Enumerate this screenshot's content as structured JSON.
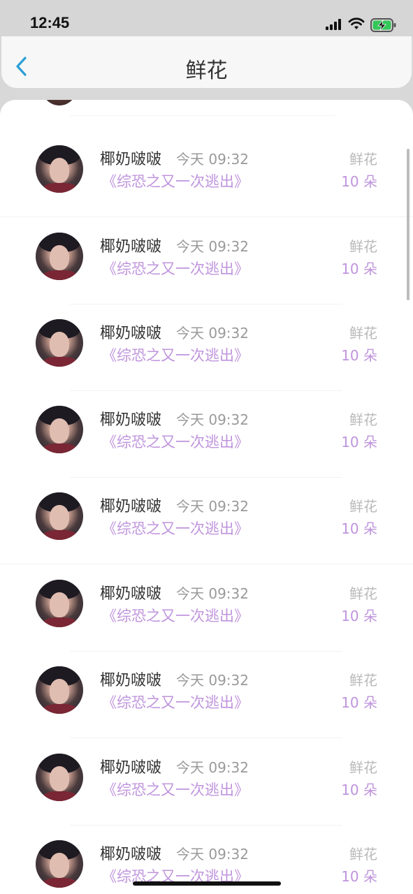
{
  "status_bar": {
    "time": "12:45"
  },
  "nav": {
    "title": "鲜花"
  },
  "records": [
    {
      "user": "椰奶啵啵",
      "time": "今天 09:32",
      "book": "《综恐之又一次逃出》",
      "gift_type": "鲜花",
      "gift_count": "10 朵"
    },
    {
      "user": "椰奶啵啵",
      "time": "今天 09:32",
      "book": "《综恐之又一次逃出》",
      "gift_type": "鲜花",
      "gift_count": "10 朵"
    },
    {
      "user": "椰奶啵啵",
      "time": "今天 09:32",
      "book": "《综恐之又一次逃出》",
      "gift_type": "鲜花",
      "gift_count": "10 朵"
    },
    {
      "user": "椰奶啵啵",
      "time": "今天 09:32",
      "book": "《综恐之又一次逃出》",
      "gift_type": "鲜花",
      "gift_count": "10 朵"
    },
    {
      "user": "椰奶啵啵",
      "time": "今天 09:32",
      "book": "《综恐之又一次逃出》",
      "gift_type": "鲜花",
      "gift_count": "10 朵"
    },
    {
      "user": "椰奶啵啵",
      "time": "今天 09:32",
      "book": "《综恐之又一次逃出》",
      "gift_type": "鲜花",
      "gift_count": "10 朵"
    },
    {
      "user": "椰奶啵啵",
      "time": "今天 09:32",
      "book": "《综恐之又一次逃出》",
      "gift_type": "鲜花",
      "gift_count": "10 朵"
    },
    {
      "user": "椰奶啵啵",
      "time": "今天 09:32",
      "book": "《综恐之又一次逃出》",
      "gift_type": "鲜花",
      "gift_count": "10 朵"
    },
    {
      "user": "椰奶啵啵",
      "time": "今天 09:32",
      "book": "《综恐之又一次逃出》",
      "gift_type": "鲜花",
      "gift_count": "10 朵"
    }
  ],
  "icons": {
    "back": "chevron-left-icon",
    "signal": "cellular-signal-icon",
    "wifi": "wifi-icon",
    "battery": "battery-charging-icon"
  },
  "colors": {
    "accent_purple": "#bf94dd",
    "back_blue": "#2a9fd6",
    "battery_green": "#34c759"
  }
}
